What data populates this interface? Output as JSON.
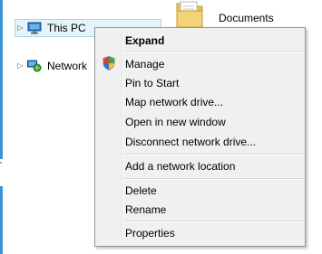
{
  "nav_pane": {
    "items": [
      {
        "label": "This PC",
        "icon": "this-pc-icon",
        "expander": "▷",
        "selected": true
      },
      {
        "label": "Network",
        "icon": "network-icon",
        "expander": "▷",
        "selected": false
      }
    ]
  },
  "content": {
    "items": [
      {
        "label": "Documents",
        "icon": "folder-icon"
      }
    ]
  },
  "context_menu": {
    "items": [
      {
        "label": "Expand",
        "bold": true
      },
      {
        "label": "Manage",
        "icon": "uac-shield-icon"
      },
      {
        "label": "Pin to Start"
      },
      {
        "label": "Map network drive..."
      },
      {
        "label": "Open in new window"
      },
      {
        "label": "Disconnect network drive..."
      },
      {
        "label": "Add a network location"
      },
      {
        "label": "Delete"
      },
      {
        "label": "Rename"
      },
      {
        "label": "Properties"
      }
    ]
  },
  "colors": {
    "selection_bg": "#e5f3fb",
    "selection_border": "#a8d2ef",
    "menu_bg": "#f0f0f0",
    "accent": "#3a93d2"
  }
}
